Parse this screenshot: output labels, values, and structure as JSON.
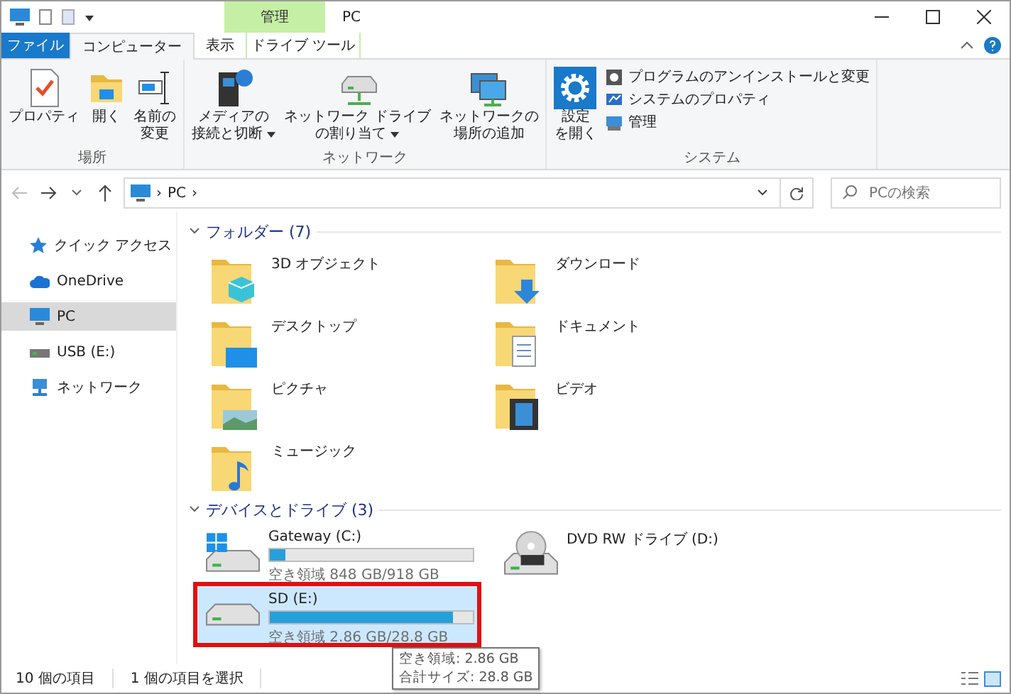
{
  "window": {
    "title": "PC",
    "context_header": "管理"
  },
  "tabs": [
    {
      "label": "ファイル",
      "kind": "file",
      "selected": false
    },
    {
      "label": "コンピューター",
      "kind": "normal",
      "selected": true
    },
    {
      "label": "表示",
      "kind": "normal",
      "selected": false
    },
    {
      "label": "ドライブ ツール",
      "kind": "context",
      "selected": false
    }
  ],
  "ribbon_groups": [
    {
      "label": "場所",
      "buttons": [
        {
          "lines": [
            "プロパティ"
          ],
          "has_menu": false
        },
        {
          "lines": [
            "開く"
          ],
          "has_menu": false
        },
        {
          "lines": [
            "名前の",
            "変更"
          ],
          "has_menu": false
        }
      ]
    },
    {
      "label": "ネットワーク",
      "buttons": [
        {
          "lines": [
            "メディアの",
            "接続と切断"
          ],
          "has_menu": true
        },
        {
          "lines": [
            "ネットワーク ドライブ",
            "の割り当て"
          ],
          "has_menu": true
        },
        {
          "lines": [
            "ネットワークの",
            "場所の追加"
          ],
          "has_menu": false
        }
      ]
    },
    {
      "label": "システム",
      "buttons": [
        {
          "lines": [
            "設定",
            "を開く"
          ],
          "has_menu": false
        }
      ],
      "small_buttons": [
        "プログラムのアンインストールと変更",
        "システムのプロパティ",
        "管理"
      ]
    }
  ],
  "address": {
    "crumbs": [
      "›",
      "PC",
      "›"
    ],
    "search_placeholder": "PCの検索"
  },
  "sidebar": [
    {
      "label": "クイック アクセス",
      "selected": false
    },
    {
      "label": "OneDrive",
      "selected": false
    },
    {
      "label": "PC",
      "selected": true
    },
    {
      "label": "USB (E:)",
      "selected": false
    },
    {
      "label": "ネットワーク",
      "selected": false
    }
  ],
  "folders": {
    "title": "フォルダー (7)",
    "expanded": true,
    "items": [
      "3D オブジェクト",
      "ダウンロード",
      "デスクトップ",
      "ドキュメント",
      "ピクチャ",
      "ビデオ",
      "ミュージック"
    ]
  },
  "drives": {
    "title": "デバイスとドライブ (3)",
    "expanded": true,
    "items": [
      {
        "name": "Gateway (C:)",
        "kind": "disk",
        "level": 0.08,
        "free": "空き領域 848 GB/918 GB",
        "selected": false,
        "highlighted": false
      },
      {
        "name": "DVD RW ドライブ (D:)",
        "kind": "optical",
        "selected": false,
        "highlighted": false
      },
      {
        "name": "SD (E:)",
        "kind": "disk",
        "level": 0.9,
        "free": "空き領域 2.86 GB/28.8 GB",
        "selected": true,
        "highlighted": true
      }
    ]
  },
  "tooltip": [
    "空き領域: 2.86 GB",
    "合計サイズ: 28.8 GB"
  ],
  "status_bar": [
    "10 個の項目",
    "1 個の項目を選択"
  ]
}
